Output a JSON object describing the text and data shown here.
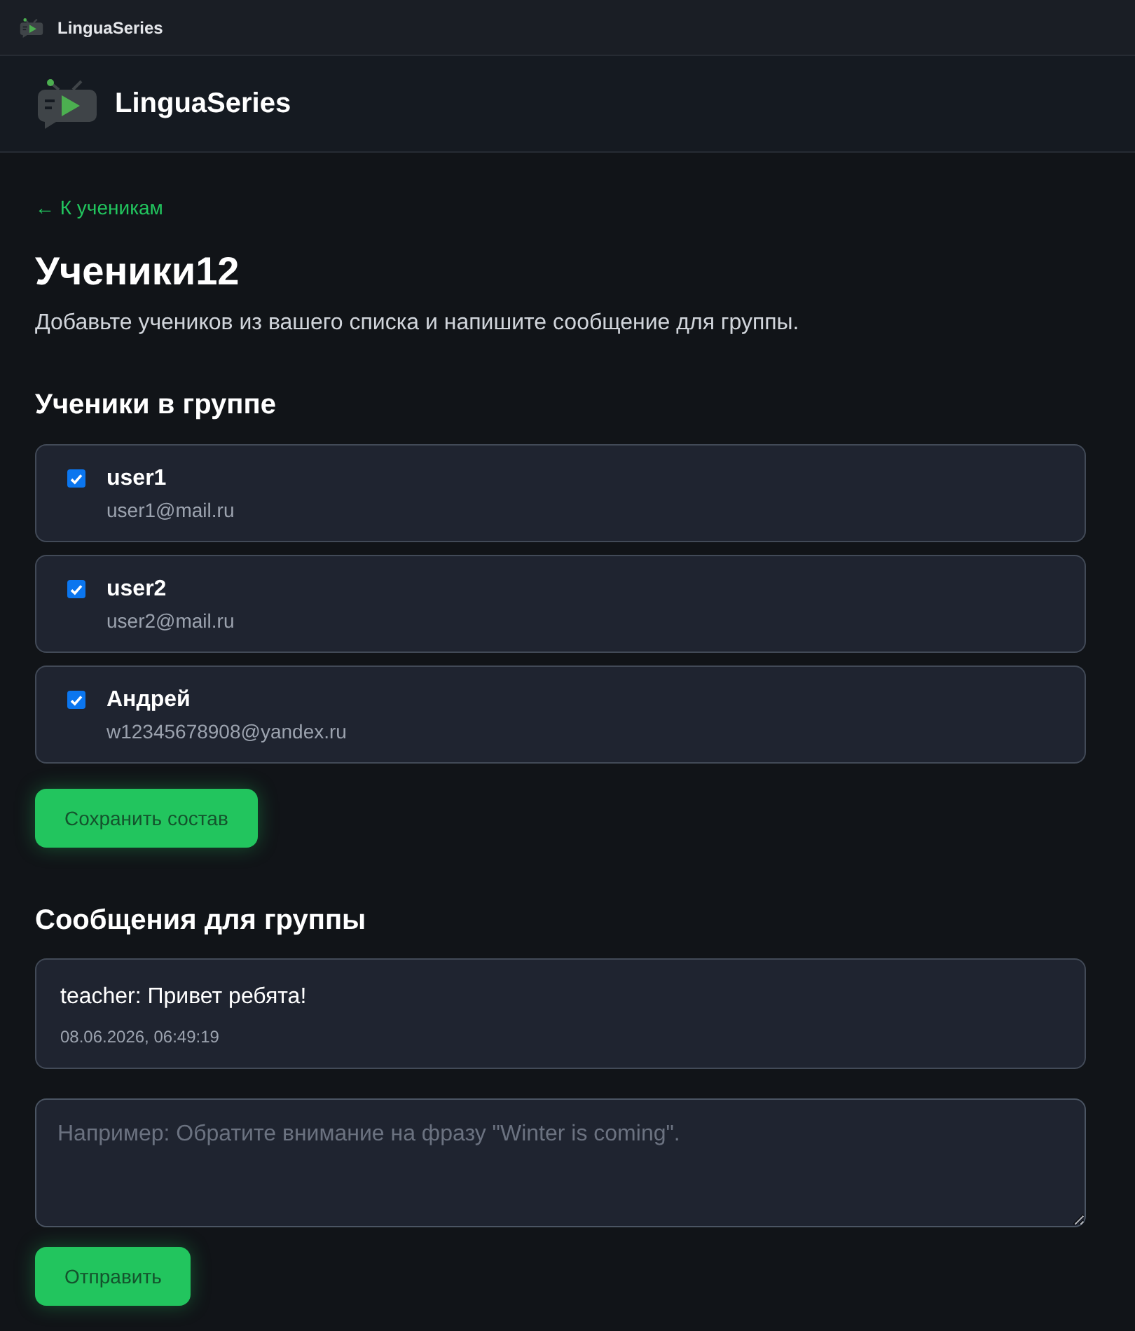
{
  "window": {
    "title": "LinguaSeries"
  },
  "header": {
    "brand": "LinguaSeries"
  },
  "back_link": "← К ученикам",
  "page": {
    "title": "Ученики12",
    "subtitle": "Добавьте учеников из вашего списка и напишите сообщение для группы."
  },
  "members": {
    "heading": "Ученики в группе",
    "students": [
      {
        "name": "user1",
        "email": "user1@mail.ru",
        "checked": true
      },
      {
        "name": "user2",
        "email": "user2@mail.ru",
        "checked": true
      },
      {
        "name": "Андрей",
        "email": "w12345678908@yandex.ru",
        "checked": true
      }
    ],
    "save_button": "Сохранить состав"
  },
  "messages": {
    "heading": "Сообщения для группы",
    "items": [
      {
        "text": "teacher: Привет ребята!",
        "time": "08.06.2026, 06:49:19"
      }
    ],
    "composer": {
      "placeholder": "Например: Обратите внимание на фразу \"Winter is coming\"."
    },
    "send_button": "Отправить"
  }
}
